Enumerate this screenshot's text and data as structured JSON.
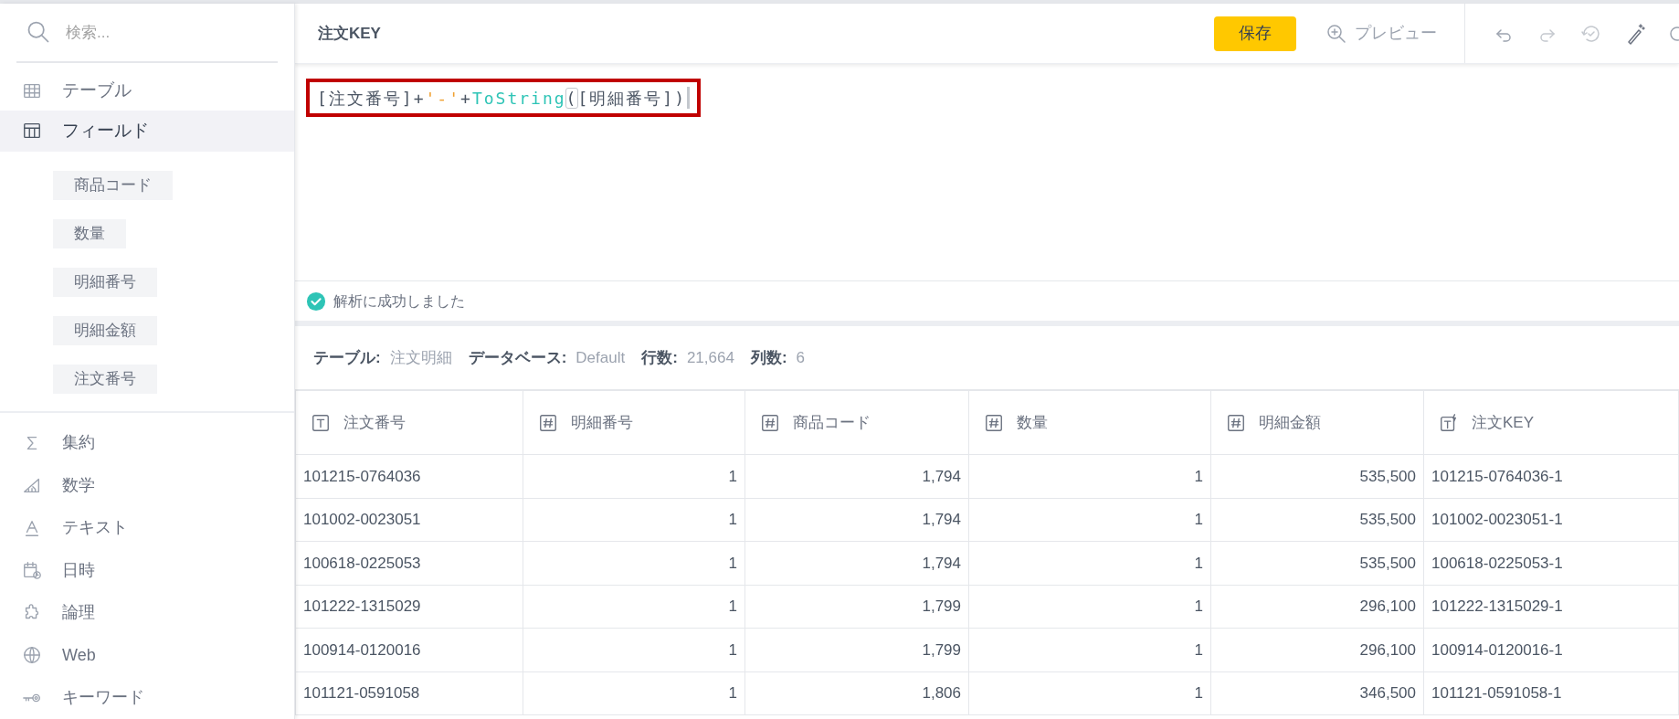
{
  "sidebar": {
    "search": {
      "placeholder": "検索..."
    },
    "nav": [
      {
        "label": "テーブル",
        "kind": "table",
        "selected": false
      },
      {
        "label": "フィールド",
        "kind": "fields",
        "selected": true
      }
    ],
    "fields": [
      "商品コード",
      "数量",
      "明細番号",
      "明細金額",
      "注文番号"
    ],
    "categories": [
      {
        "label": "集約",
        "kind": "sigma"
      },
      {
        "label": "数学",
        "kind": "math"
      },
      {
        "label": "テキスト",
        "kind": "text"
      },
      {
        "label": "日時",
        "kind": "datetime"
      },
      {
        "label": "論理",
        "kind": "logic"
      },
      {
        "label": "Web",
        "kind": "web"
      },
      {
        "label": "キーワード",
        "kind": "key"
      }
    ]
  },
  "editor": {
    "title": "注文KEY",
    "save": "保存",
    "preview": "プレビュー",
    "formula": [
      {
        "text": "[注文番号]",
        "kind": "field"
      },
      {
        "text": "+",
        "kind": "op"
      },
      {
        "text": "'-'",
        "kind": "string"
      },
      {
        "text": "+",
        "kind": "op"
      },
      {
        "text": "ToString",
        "kind": "function"
      },
      {
        "text": "(",
        "kind": "paren"
      },
      {
        "text": "[明細番号]",
        "kind": "field"
      },
      {
        "text": ")",
        "kind": "op"
      }
    ],
    "status": "解析に成功しました"
  },
  "info": [
    {
      "label": "テーブル:",
      "value": "注文明細"
    },
    {
      "label": "データベース:",
      "value": "Default"
    },
    {
      "label": "行数:",
      "value": "21,664"
    },
    {
      "label": "列数:",
      "value": "6"
    }
  ],
  "table": {
    "columns": [
      {
        "name": "注文番号",
        "kind": "text"
      },
      {
        "name": "明細番号",
        "kind": "number"
      },
      {
        "name": "商品コード",
        "kind": "number"
      },
      {
        "name": "数量",
        "kind": "number"
      },
      {
        "name": "明細金額",
        "kind": "number"
      },
      {
        "name": "注文KEY",
        "kind": "calc"
      }
    ],
    "rows": [
      [
        "101215-0764036",
        "1",
        "1,794",
        "1",
        "535,500",
        "101215-0764036-1"
      ],
      [
        "101002-0023051",
        "1",
        "1,794",
        "1",
        "535,500",
        "101002-0023051-1"
      ],
      [
        "100618-0225053",
        "1",
        "1,794",
        "1",
        "535,500",
        "100618-0225053-1"
      ],
      [
        "101222-1315029",
        "1",
        "1,799",
        "1",
        "296,100",
        "101222-1315029-1"
      ],
      [
        "100914-0120016",
        "1",
        "1,799",
        "1",
        "296,100",
        "100914-0120016-1"
      ],
      [
        "101121-0591058",
        "1",
        "1,806",
        "1",
        "346,500",
        "101121-0591058-1"
      ]
    ]
  }
}
